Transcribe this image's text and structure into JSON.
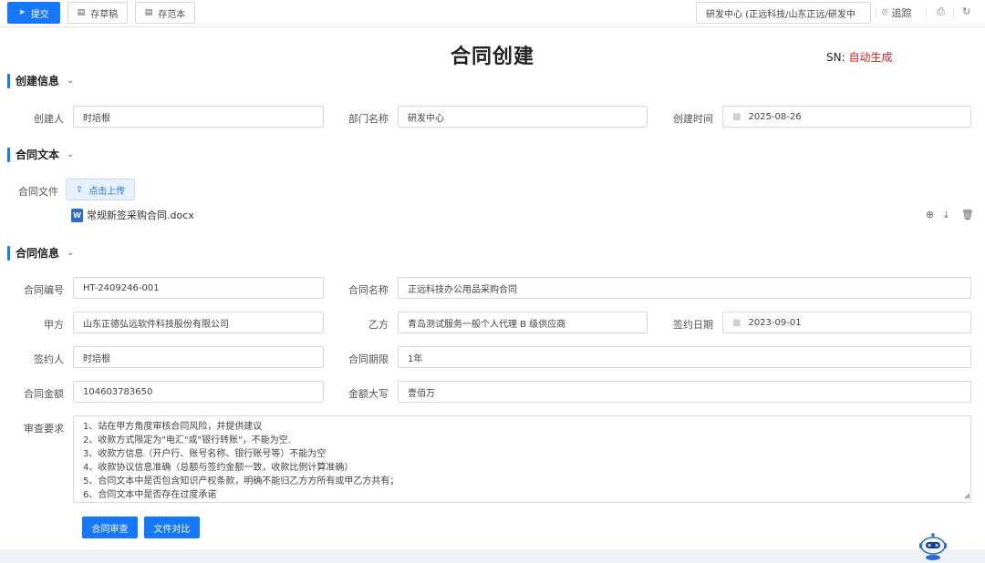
{
  "toolbar": {
    "submit_label": "提交",
    "draft_label": "存草稿",
    "template_label": "存范本",
    "department_select": "研发中心 (正远科技/山东正远/研发中",
    "track_label": "追踪",
    "icons": [
      "send-icon",
      "draft-icon",
      "template-icon",
      "location-icon",
      "print-icon",
      "refresh-icon"
    ]
  },
  "page": {
    "title": "合同创建",
    "sn_label": "SN:",
    "sn_value": "自动生成"
  },
  "creator_section": {
    "title": "创建信息",
    "creator_label": "创建人",
    "creator_value": "时培根",
    "department_label": "部门名称",
    "department_value": "研发中心",
    "create_time_label": "创建时间",
    "create_time_value": "2025-08-26"
  },
  "contract_text_section": {
    "title": "合同文本",
    "file_label": "合同文件",
    "upload_label": "点击上传",
    "file_icon_text": "W",
    "file_name": "常规新签采购合同.docx"
  },
  "contract_info_section": {
    "title": "合同信息",
    "contract_no_label": "合同编号",
    "contract_no_value": "HT-2409246-001",
    "contract_name_label": "合同名称",
    "contract_name_value": "正远科技办公用品采购合同",
    "party_a_label": "甲方",
    "party_a_value": "山东正德弘远软件科技股份有限公司",
    "party_b_label": "乙方",
    "party_b_value": "青岛测试服务一般个人代理 B 级供应商",
    "sign_date_label": "签约日期",
    "sign_date_value": "2023-09-01",
    "signer_label": "签约人",
    "signer_value": "时培根",
    "term_label": "合同期限",
    "term_value": "1年",
    "amount_label": "合同金额",
    "amount_value": "104603783650",
    "amount_upper_label": "金额大写",
    "amount_upper_value": "壹佰万",
    "review_label": "审查要求",
    "review_lines": [
      "1、站在甲方角度审核合同风险，并提供建议",
      "2、收款方式限定为\"电汇\"或\"银行转账\"，不能为空.",
      "3、收款方信息（开户行、账号名称、银行账号等）不能为空",
      "4、收款协议信息准确（总额与签约金额一致，收款比例计算准确）",
      "5、合同文本中是否包含知识产权条款，明确不能归乙方方所有或甲乙方共有；",
      "6、合同文本中是否存在过度承诺"
    ],
    "review_button": "合同审查",
    "compare_button": "文件对比"
  },
  "colors": {
    "primary": "#1677ff",
    "danger": "#e02020"
  }
}
